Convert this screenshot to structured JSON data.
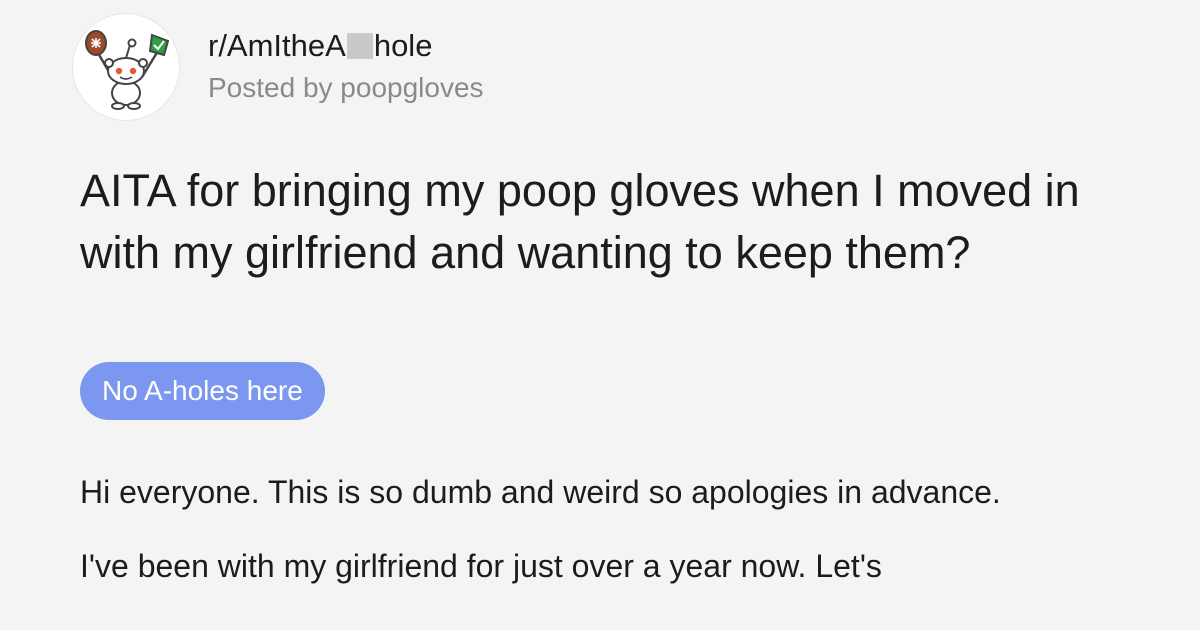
{
  "post": {
    "subreddit_prefix": "r/AmItheA",
    "subreddit_suffix": "hole",
    "posted_by": "Posted by poopgloves",
    "title": "AITA for bringing my poop gloves when I moved in with my girlfriend and wanting to keep them?",
    "flair": "No A-holes here",
    "paragraphs": [
      "Hi everyone. This is so dumb and weird so apologies in advance.",
      "I've been with my girlfriend for just over a year now. Let's"
    ]
  },
  "icons": {
    "avatar": "snoo-judge-icon"
  },
  "colors": {
    "background": "#f4f4f4",
    "flair_bg": "#7b97ef",
    "flair_text": "#ffffff",
    "meta_text": "#8a8a8a",
    "text": "#1c1c1c"
  }
}
